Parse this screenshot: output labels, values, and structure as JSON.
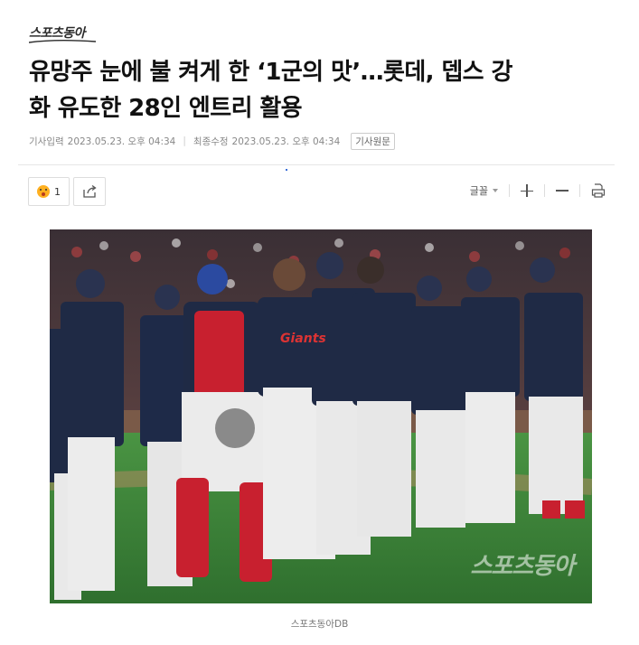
{
  "header": {
    "logo_text": "스포츠동아"
  },
  "article": {
    "headline_line1": "유망주 눈에 불 켜게 한 ‘1군의 맛’…롯데, 뎁스 강",
    "headline_line2": "화 유도한 28인 엔트리 활용",
    "published_label": "기사입력",
    "published_time": "2023.05.23. 오후 04:34",
    "modified_label": "최종수정",
    "modified_time": "2023.05.23. 오후 04:34",
    "original_button": "기사원문"
  },
  "toolbar": {
    "reaction_count": "1",
    "reaction_icon": "surprised-face-icon",
    "share_icon": "share-icon",
    "font_label": "글꼴",
    "zoom_in_icon": "plus-icon",
    "zoom_out_icon": "minus-icon",
    "print_icon": "print-icon"
  },
  "photo": {
    "watermark": "스포츠동아",
    "jersey_text": "Giants",
    "caption": "스포츠동아DB"
  },
  "colors": {
    "jersey_navy": "#1f2a45",
    "pants_white": "#e9e9e9",
    "field_green": "#3f8a3c",
    "accent_red": "#c8202f"
  }
}
